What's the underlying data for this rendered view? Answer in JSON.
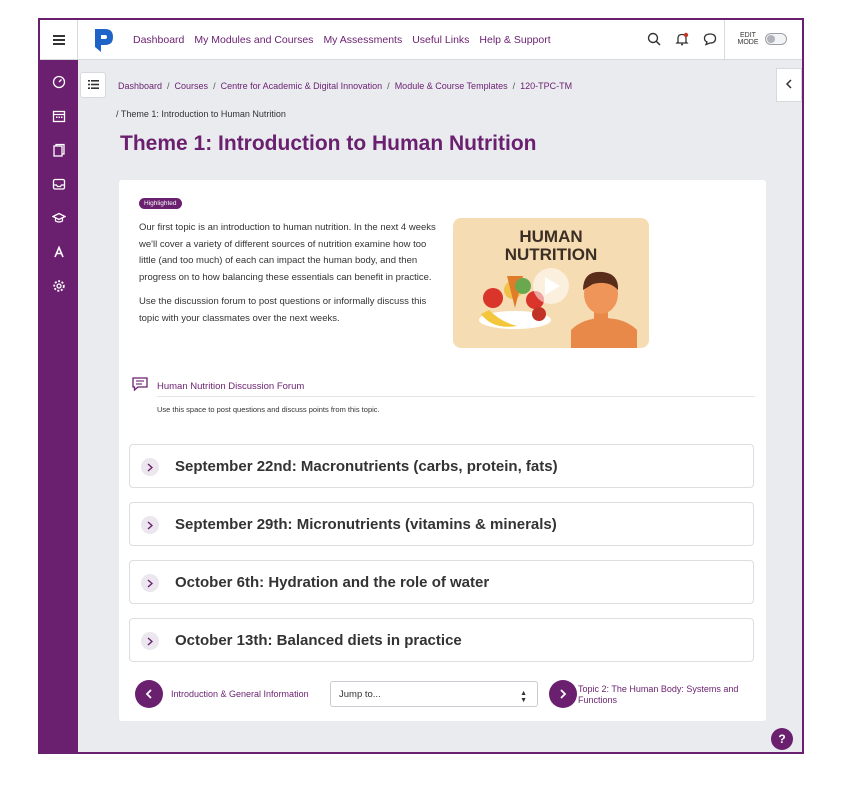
{
  "nav": {
    "links": [
      "Dashboard",
      "My Modules and Courses",
      "My Assessments",
      "Useful Links",
      "Help & Support"
    ],
    "edit_mode_label_1": "EDIT",
    "edit_mode_label_2": "MODE"
  },
  "breadcrumb": {
    "items": [
      "Dashboard",
      "Courses",
      "Centre for Academic & Digital Innovation",
      "Module & Course Templates",
      "120-TPC-TM"
    ],
    "current": "Theme 1: Introduction to Human Nutrition"
  },
  "page_title": "Theme 1: Introduction to Human Nutrition",
  "card": {
    "badge": "Highlighted",
    "intro_p1": "Our first topic is an introduction to human nutrition. In the next 4 weeks we'll cover a variety of different sources of nutrition examine how too little (and too much) of each can impact the human body, and then progress on to how balancing these essentials can benefit in practice.",
    "intro_p2": "Use the discussion forum to post questions or informally discuss this topic with your classmates over the next weeks.",
    "video_title_1": "HUMAN",
    "video_title_2": "NUTRITION",
    "forum_link": "Human Nutrition Discussion Forum",
    "forum_desc": "Use this space to post questions and discuss points from this topic."
  },
  "sections": [
    "September 22nd: Macronutrients (carbs, protein, fats)",
    "September 29th: Micronutrients (vitamins & minerals)",
    "October 6th: Hydration and the role of water",
    "October 13th: Balanced diets in practice"
  ],
  "bottom_nav": {
    "prev": "Introduction & General Information",
    "jump_placeholder": "Jump to...",
    "next": "Topic 2: The Human Body: Systems and Functions"
  },
  "help": "?",
  "colors": {
    "brand": "#6a1f6f",
    "background": "#e9ebef",
    "logo_blue": "#1e64c8"
  }
}
